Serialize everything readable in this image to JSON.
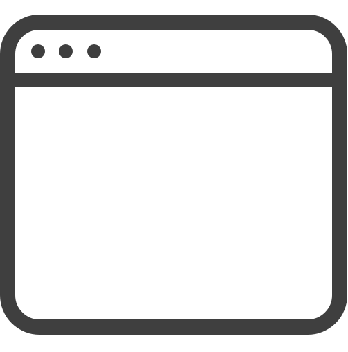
{
  "icon": {
    "name": "browser-window-icon",
    "stroke_color": "#3f3f3f",
    "fill_color": "#ffffff",
    "control_dots": [
      {
        "name": "window-control-dot-1"
      },
      {
        "name": "window-control-dot-2"
      },
      {
        "name": "window-control-dot-3"
      }
    ]
  }
}
